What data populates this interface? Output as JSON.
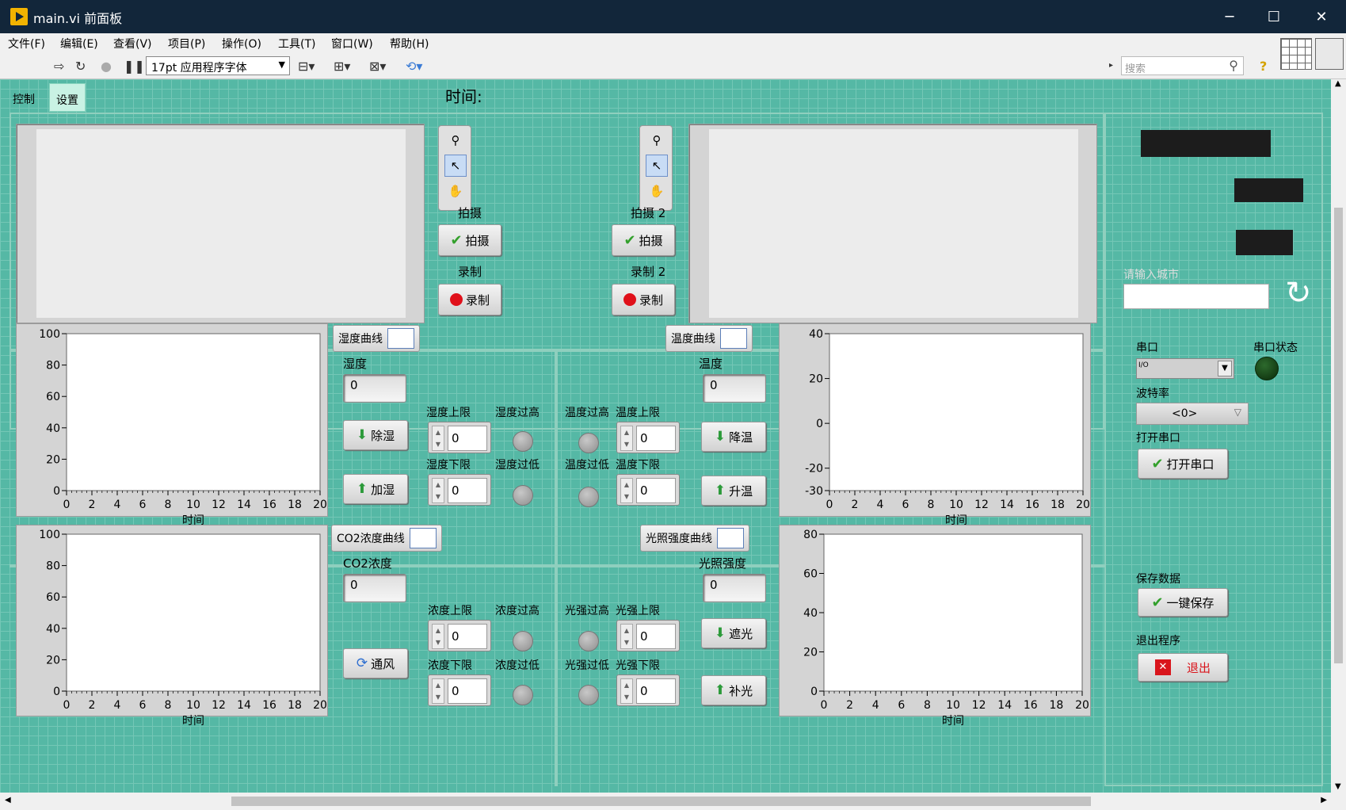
{
  "window": {
    "title": "main.vi 前面板"
  },
  "menu": [
    "文件(F)",
    "编辑(E)",
    "查看(V)",
    "项目(P)",
    "操作(O)",
    "工具(T)",
    "窗口(W)",
    "帮助(H)"
  ],
  "toolbar": {
    "font": "17pt 应用程序字体",
    "search_placeholder": "搜索"
  },
  "tabs": [
    {
      "label": "控制"
    },
    {
      "label": "设置"
    }
  ],
  "time_label": "时间:",
  "camera": {
    "cap1_label": "拍摄",
    "cap1_btn": "拍摄",
    "rec1_label": "录制",
    "rec1_btn": "录制",
    "cap2_label": "拍摄 2",
    "cap2_btn": "拍摄",
    "rec2_label": "录制 2",
    "rec2_btn": "录制"
  },
  "city_label": "请输入城市",
  "humidity": {
    "curve_btn": "湿度曲线",
    "value_label": "湿度",
    "value": "0",
    "dehum_btn": "除湿",
    "hum_btn": "加湿",
    "upper_label": "湿度上限",
    "upper": "0",
    "lower_label": "湿度下限",
    "lower": "0",
    "high_label": "湿度过高",
    "low_label": "湿度过低"
  },
  "temperature": {
    "curve_btn": "温度曲线",
    "value_label": "温度",
    "value": "0",
    "cool_btn": "降温",
    "heat_btn": "升温",
    "upper_label": "温度上限",
    "upper": "0",
    "lower_label": "温度下限",
    "lower": "0",
    "high_label": "温度过高",
    "low_label": "温度过低"
  },
  "co2": {
    "curve_btn": "CO2浓度曲线",
    "value_label": "CO2浓度",
    "value": "0",
    "vent_btn": "通风",
    "upper_label": "浓度上限",
    "upper": "0",
    "lower_label": "浓度下限",
    "lower": "0",
    "high_label": "浓度过高",
    "low_label": "浓度过低"
  },
  "light": {
    "curve_btn": "光照强度曲线",
    "value_label": "光照强度",
    "value": "0",
    "shade_btn": "遮光",
    "fill_btn": "补光",
    "upper_label": "光强上限",
    "upper": "0",
    "lower_label": "光强下限",
    "lower": "0",
    "high_label": "光强过高",
    "low_label": "光强过低"
  },
  "serial": {
    "port_label": "串口",
    "port_value": "I/O",
    "status_label": "串口状态",
    "baud_label": "波特率",
    "baud_value": "<0>",
    "open_label": "打开串口",
    "open_btn": "打开串口"
  },
  "save": {
    "label": "保存数据",
    "btn": "一键保存"
  },
  "exit": {
    "label": "退出程序",
    "btn": "退出"
  },
  "chart_data": [
    {
      "type": "line",
      "title": "",
      "xlabel": "时间",
      "ylabel": "",
      "xlim": [
        0,
        20
      ],
      "ylim": [
        0,
        100
      ],
      "xticks": [
        "0",
        "2",
        "4",
        "6",
        "8",
        "10",
        "12",
        "14",
        "16",
        "18",
        "20"
      ],
      "yticks": [
        "100",
        "80",
        "60",
        "40",
        "20",
        "0"
      ],
      "series": []
    },
    {
      "type": "line",
      "title": "",
      "xlabel": "时间",
      "ylabel": "",
      "xlim": [
        0,
        20
      ],
      "ylim": [
        -30,
        40
      ],
      "xticks": [
        "0",
        "2",
        "4",
        "6",
        "8",
        "10",
        "12",
        "14",
        "16",
        "18",
        "20"
      ],
      "yticks": [
        "40",
        "20",
        "0",
        "-20",
        "-30"
      ],
      "series": []
    },
    {
      "type": "line",
      "title": "",
      "xlabel": "时间",
      "ylabel": "",
      "xlim": [
        0,
        20
      ],
      "ylim": [
        0,
        100
      ],
      "xticks": [
        "0",
        "2",
        "4",
        "6",
        "8",
        "10",
        "12",
        "14",
        "16",
        "18",
        "20"
      ],
      "yticks": [
        "100",
        "80",
        "60",
        "40",
        "20",
        "0"
      ],
      "series": []
    },
    {
      "type": "line",
      "title": "",
      "xlabel": "时间",
      "ylabel": "",
      "xlim": [
        0,
        20
      ],
      "ylim": [
        0,
        80
      ],
      "xticks": [
        "0",
        "2",
        "4",
        "6",
        "8",
        "10",
        "12",
        "14",
        "16",
        "18",
        "20"
      ],
      "yticks": [
        "80",
        "60",
        "40",
        "20",
        "0"
      ],
      "series": []
    }
  ]
}
